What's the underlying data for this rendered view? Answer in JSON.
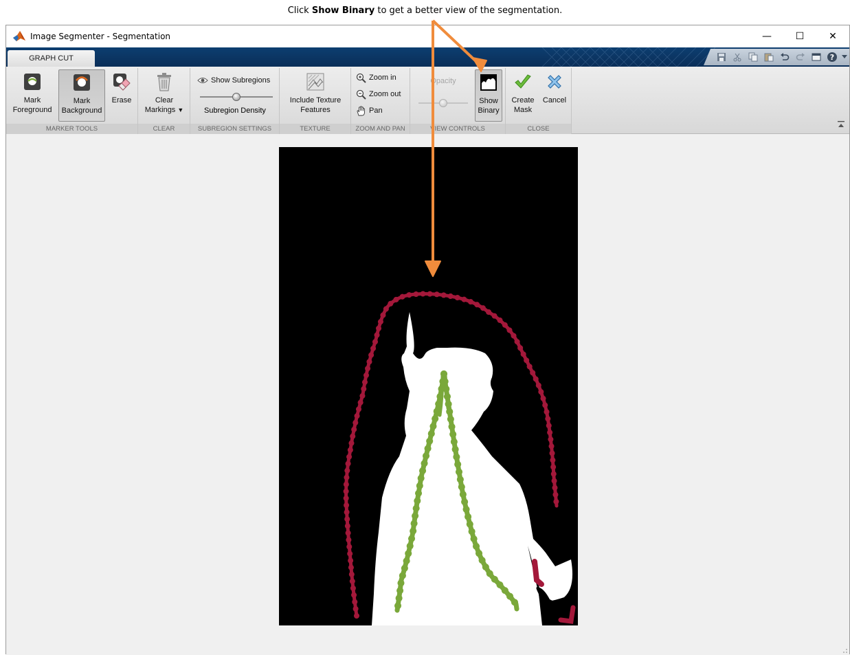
{
  "annotation": {
    "prefix": "Click",
    "bold": "Show Binary",
    "suffix": "to get a better view of the segmentation."
  },
  "window": {
    "title": "Image Segmenter - Segmentation",
    "controls": {
      "minimize": "—",
      "maximize": "☐",
      "close": "✕"
    }
  },
  "tab": {
    "label": "GRAPH CUT"
  },
  "quick_access_icons": [
    "save-icon",
    "cut-icon",
    "copy-icon",
    "paste-icon",
    "undo-icon",
    "redo-icon",
    "layout-icon",
    "help-icon",
    "dropdown-icon"
  ],
  "ribbon": {
    "marker_tools": {
      "label": "MARKER TOOLS",
      "mark_foreground_line1": "Mark",
      "mark_foreground_line2": "Foreground",
      "mark_background_line1": "Mark",
      "mark_background_line2": "Background",
      "erase": "Erase"
    },
    "clear": {
      "label": "CLEAR",
      "line1": "Clear",
      "line2": "Markings"
    },
    "subregion_settings": {
      "label": "SUBREGION SETTINGS",
      "show_subregions": "Show Subregions",
      "density_label": "Subregion Density"
    },
    "texture": {
      "label": "TEXTURE",
      "line1": "Include Texture",
      "line2": "Features"
    },
    "zoom_and_pan": {
      "label": "ZOOM AND PAN",
      "zoom_in": "Zoom in",
      "zoom_out": "Zoom out",
      "pan": "Pan"
    },
    "view_controls": {
      "label": "VIEW CONTROLS",
      "opacity": "Opacity",
      "show_binary_line1": "Show",
      "show_binary_line2": "Binary"
    },
    "close": {
      "label": "CLOSE",
      "create_mask_line1": "Create",
      "create_mask_line2": "Mask",
      "cancel": "Cancel"
    }
  },
  "colors": {
    "foreground_marker": "#7aa83a",
    "background_marker": "#a3183a",
    "annotation_arrow": "#f08c3c",
    "tabstrip": "#0d3e70"
  }
}
